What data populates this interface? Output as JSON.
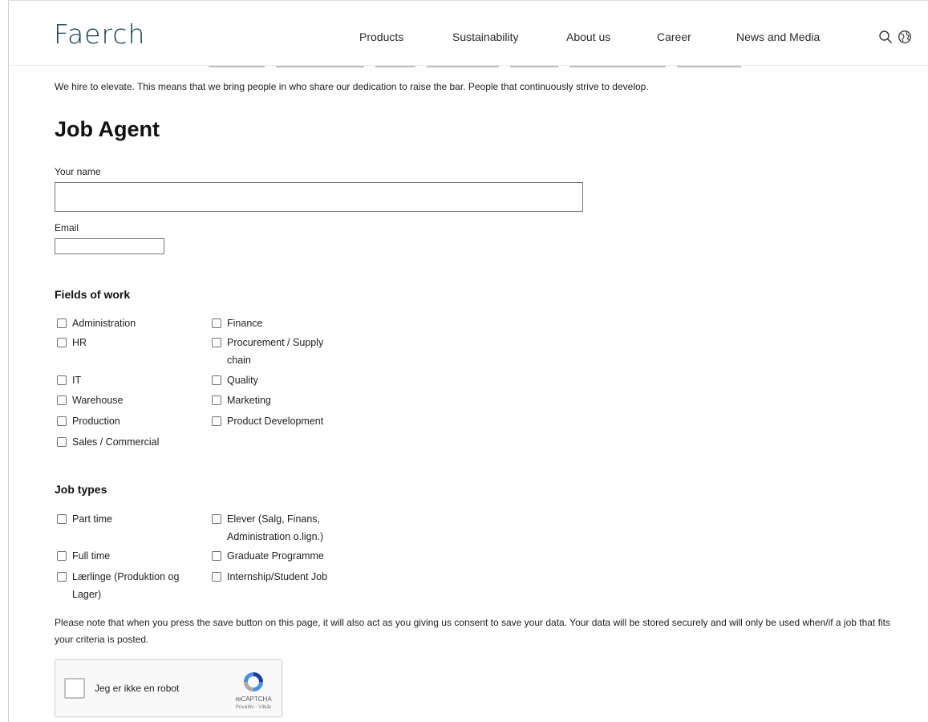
{
  "header": {
    "logo": "Faerch",
    "nav": [
      "Products",
      "Sustainability",
      "About us",
      "Career",
      "News and Media"
    ],
    "icons": [
      "search-icon",
      "globe-icon"
    ]
  },
  "intro_text": "We hire to elevate. This means that we bring people in who share our dedication to raise the bar. People that continuously strive to develop.",
  "form": {
    "title": "Job Agent",
    "name_label": "Your name",
    "name_value": "",
    "email_label": "Email",
    "email_value": "",
    "fields_title": "Fields of work",
    "fields": [
      {
        "label": "Administration",
        "checked": false
      },
      {
        "label": "Finance",
        "checked": false
      },
      {
        "label": "HR",
        "checked": false
      },
      {
        "label": "Procurement / Supply chain",
        "checked": false
      },
      {
        "label": "IT",
        "checked": false
      },
      {
        "label": "Quality",
        "checked": false
      },
      {
        "label": "Warehouse",
        "checked": false
      },
      {
        "label": "Marketing",
        "checked": false
      },
      {
        "label": "Production",
        "checked": false
      },
      {
        "label": "Product Development",
        "checked": false
      },
      {
        "label": "Sales / Commercial",
        "checked": false
      }
    ],
    "job_types_title": "Job types",
    "job_types": [
      {
        "label": "Part time",
        "checked": false
      },
      {
        "label": "Elever (Salg, Finans, Administration o.lign.)",
        "checked": false
      },
      {
        "label": "Full time",
        "checked": false
      },
      {
        "label": "Graduate Programme",
        "checked": false
      },
      {
        "label": "Lærlinge (Produktion og Lager)",
        "checked": false
      },
      {
        "label": "Internship/Student Job",
        "checked": false
      }
    ],
    "consent_note": "Please note that when you press the save button on this page, it will also act as you giving us consent to save your data. Your data will be stored securely and will only be used when/if a job that fits your criteria is posted."
  },
  "captcha": {
    "label": "Jeg er ikke en robot",
    "brand": "reCAPTCHA",
    "terms": "Privatliv - Vilkår",
    "checked": false
  },
  "colors": {
    "logo": "#15404a",
    "text": "#222222",
    "border": "#767676"
  }
}
